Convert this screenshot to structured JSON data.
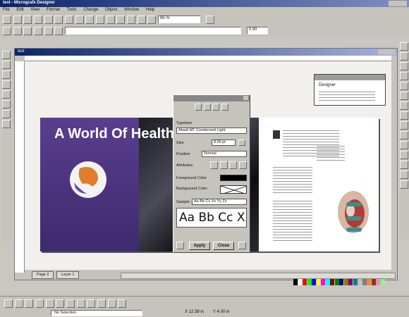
{
  "app": {
    "title": "test - Micrografx Designer",
    "menu": [
      "File",
      "Edit",
      "View",
      "Format",
      "Tools",
      "Change",
      "Object",
      "Window",
      "Help"
    ]
  },
  "toolbar": {
    "zoom_value": "85 %",
    "second_field_value": "0.00"
  },
  "document": {
    "tab_title": "test",
    "headline": "A World Of Health",
    "page_tabs": [
      "Page 2",
      "Layer 1"
    ]
  },
  "dialog": {
    "typeface_label": "Typeface",
    "typeface_value": "Abadi MT Condensed Light",
    "size_label": "Size",
    "size_value": "8.00 pt",
    "position_label": "Position",
    "position_value": "Normal",
    "attributes_label": "Attributes",
    "foreground_label": "Foreground Color",
    "background_label": "Background Color",
    "sample_label": "Sample",
    "sample_field": "Aa Bb Cc Xx Yy Zz",
    "sample_preview": "Aa Bb Cc Xx Y",
    "apply_label": "Apply",
    "close_label": "Close"
  },
  "small_panel": {
    "title": "Designer",
    "line1": "Designer"
  },
  "status": {
    "selection": "No Selection",
    "x": "X 12.38 in",
    "y": "Y 4.00 in"
  },
  "colors": {
    "titlebar": "#0a246a",
    "cover_purple": "#4b2f7e",
    "globe_orange": "#e07d2a",
    "tag_teal": "#3b8f86"
  },
  "palette_colors": [
    "#000000",
    "#ffffff",
    "#ff0000",
    "#00ff00",
    "#0000ff",
    "#ffff00",
    "#ff00ff",
    "#00ffff",
    "#800000",
    "#008000",
    "#000080",
    "#808000",
    "#800080",
    "#008080",
    "#c0c0c0",
    "#808080",
    "#ff8040",
    "#804000",
    "#ff80c0",
    "#80ff80"
  ]
}
